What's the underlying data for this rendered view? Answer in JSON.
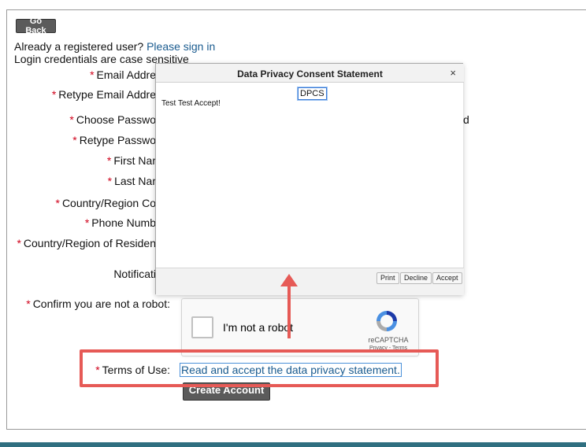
{
  "go_back_label": "Go Back",
  "intro": {
    "registered_prefix": "Already a registered user?",
    "sign_in_link": "Please sign in",
    "case_note": "Login credentials are case sensitive"
  },
  "form_labels": {
    "email": "Email Addre",
    "retype_email": "Retype Email Addre",
    "choose_password": "Choose Passwo",
    "retype_password": "Retype Passwo",
    "first_name": "First Nar",
    "last_name": "Last Nar",
    "country_code": "Country/Region Co",
    "phone": "Phone Numb",
    "country_residence": "Country/Region of Residen",
    "notifications": "Notificati",
    "robot": "Confirm you are not a robot:",
    "terms": "Terms of Use:"
  },
  "required_mark": "*",
  "side_fragment": "d",
  "modal": {
    "title": "Data Privacy Consent Statement",
    "close": "×",
    "tab_label": "DPCS",
    "body_text": "Test Test Accept!",
    "buttons": {
      "print": "Print",
      "decline": "Decline",
      "accept": "Accept"
    }
  },
  "recaptcha": {
    "label": "I'm not a robot",
    "brand": "reCAPTCHA",
    "links": "Privacy - Terms"
  },
  "terms_link": "Read and accept the data privacy statement.",
  "create_account_label": "Create Account",
  "colors": {
    "link": "#1a5b8f",
    "required": "#d0021b",
    "highlight": "#e65a56",
    "bottom_bar": "#2f6f80"
  }
}
